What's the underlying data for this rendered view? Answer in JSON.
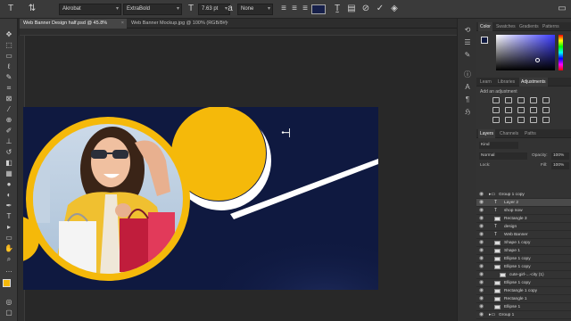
{
  "options_bar": {
    "font_family": "Akrobat",
    "font_style": "ExtraBold",
    "font_size": "7.63 pt",
    "antialias": "None",
    "text_color": "#17204a"
  },
  "tabs": [
    {
      "label": "Web Banner Design half.psd @ 45.8% (RGB/8#)",
      "active": true
    },
    {
      "label": "Web Banner Mockup.jpg @ 100% (RGB/8#)",
      "active": false
    }
  ],
  "color_panel": {
    "tabs": [
      "Color",
      "Swatches",
      "Gradients",
      "Patterns"
    ]
  },
  "adjustments_panel": {
    "tabs": [
      "Learn",
      "Libraries",
      "Adjustments"
    ],
    "hint": "Add an adjustment"
  },
  "layers_panel": {
    "tabs": [
      "Layers",
      "Channels",
      "Paths"
    ],
    "kind": "Kind",
    "blend_mode": "Normal",
    "opacity_label": "Opacity:",
    "opacity_value": "100%",
    "lock_label": "Lock:",
    "fill_label": "Fill:",
    "fill_value": "100%",
    "layers": [
      {
        "name": "Group 1 copy",
        "type": "group",
        "indent": 0,
        "selected": false
      },
      {
        "name": "Layer 2",
        "type": "text",
        "indent": 1,
        "selected": true
      },
      {
        "name": "shop now",
        "type": "text",
        "indent": 1,
        "selected": false
      },
      {
        "name": "Rectangle 3",
        "type": "shape",
        "indent": 1,
        "selected": false
      },
      {
        "name": "design",
        "type": "text",
        "indent": 1,
        "selected": false
      },
      {
        "name": "Web Banner",
        "type": "text",
        "indent": 1,
        "selected": false
      },
      {
        "name": "Shape 1 copy",
        "type": "shape",
        "indent": 1,
        "selected": false
      },
      {
        "name": "Shape 1",
        "type": "shape",
        "indent": 1,
        "selected": false
      },
      {
        "name": "Ellipse 1 copy",
        "type": "shape",
        "indent": 1,
        "selected": false
      },
      {
        "name": "Ellipse 1 copy",
        "type": "shape",
        "indent": 1,
        "selected": false
      },
      {
        "name": "cute-girl-...-city (1)",
        "type": "smart",
        "indent": 2,
        "selected": false
      },
      {
        "name": "Ellipse 1 copy",
        "type": "shape",
        "indent": 1,
        "selected": false
      },
      {
        "name": "Rectangle 1 copy",
        "type": "shape",
        "indent": 1,
        "selected": false
      },
      {
        "name": "Rectangle 1",
        "type": "shape",
        "indent": 1,
        "selected": false
      },
      {
        "name": "Ellipse 1",
        "type": "shape",
        "indent": 1,
        "selected": false
      },
      {
        "name": "Group 1",
        "type": "group",
        "indent": 0,
        "selected": false
      }
    ]
  },
  "colors": {
    "banner_bg": "#0f1940",
    "accent_yellow": "#f5b90a",
    "white": "#ffffff",
    "ui_panel": "#333333"
  }
}
